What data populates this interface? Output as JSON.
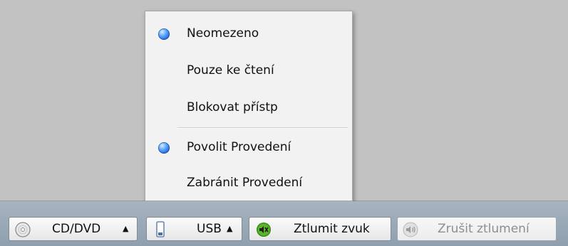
{
  "menu": {
    "items": [
      {
        "label": "Neomezeno",
        "selected": true
      },
      {
        "label": "Pouze ke čtení",
        "selected": false
      },
      {
        "label": "Blokovat přístp",
        "selected": false
      },
      {
        "label": "Povolit Provedení",
        "selected": true
      },
      {
        "label": "Zabránit Provedení",
        "selected": false
      }
    ]
  },
  "taskbar": {
    "cd": {
      "label": "CD/DVD",
      "arrow": "▲",
      "icon": "disc-icon"
    },
    "usb": {
      "label": "USB",
      "arrow": "▲",
      "icon": "usb-drive-icon"
    },
    "mute": {
      "label": "Ztlumit zvuk",
      "icon": "speaker-muted-icon"
    },
    "unmute": {
      "label": "Zrušit ztlumení",
      "icon": "speaker-icon"
    }
  }
}
